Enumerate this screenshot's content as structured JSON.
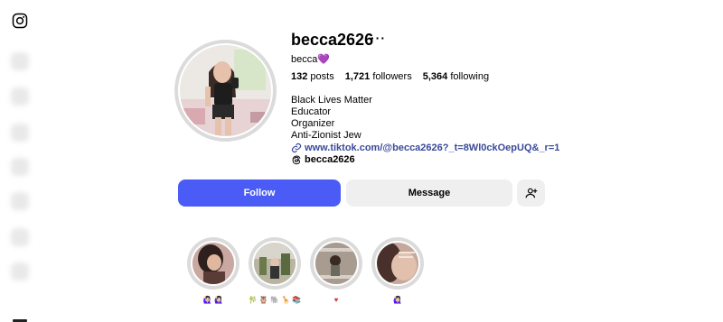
{
  "profile": {
    "username": "becca2626",
    "more_label": "···",
    "full_name": "becca",
    "full_name_emoji": "💜",
    "stats": {
      "posts_count": "132",
      "posts_label": "posts",
      "followers_count": "1,721",
      "followers_label": "followers",
      "following_count": "5,364",
      "following_label": "following"
    },
    "bio": [
      "Black Lives Matter",
      "Educator",
      "Organizer",
      "Anti-Zionist Jew"
    ],
    "link": "www.tiktok.com/@becca2626?_t=8Wl0ckOepUQ&_r=1",
    "threads_handle": "becca2626"
  },
  "actions": {
    "follow_label": "Follow",
    "message_label": "Message",
    "add_user_icon": "add-person-icon",
    "follow_color": "#4a5cf5"
  },
  "highlights": [
    {
      "label": "🙋🏻‍♀️ 🙋🏻‍♀️"
    },
    {
      "label": "🎋 🦉 🐘 🦒 📚"
    },
    {
      "label": "♥"
    },
    {
      "label": "🙋🏻‍♀️"
    }
  ],
  "icons": {
    "logo": "instagram-icon",
    "link": "link-icon",
    "threads": "threads-icon"
  }
}
